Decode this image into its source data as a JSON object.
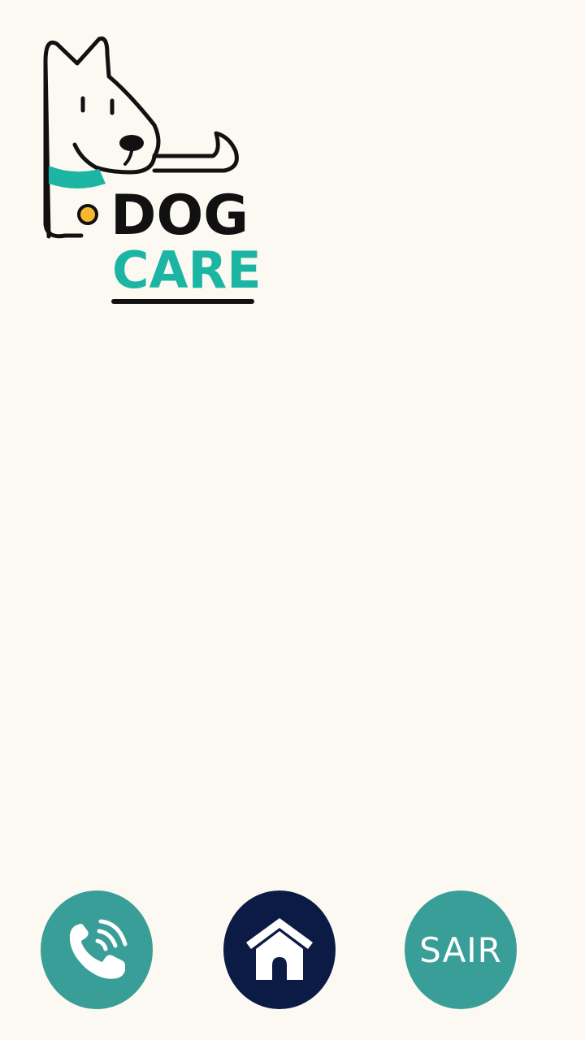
{
  "brand": {
    "line1": "DOG",
    "line2": "CARE",
    "logo_icon": "dog-icon",
    "colors": {
      "ink": "#111111",
      "accent": "#1cb5a3",
      "dot": "#f5b82e"
    }
  },
  "bottom_nav": {
    "call": {
      "icon": "phone-call-icon",
      "color": "#3a9e98"
    },
    "home": {
      "icon": "dog-house-icon",
      "color": "#0b1b45"
    },
    "exit": {
      "label": "SAIR",
      "color": "#3a9e98"
    }
  },
  "background": "#fbf9f1"
}
